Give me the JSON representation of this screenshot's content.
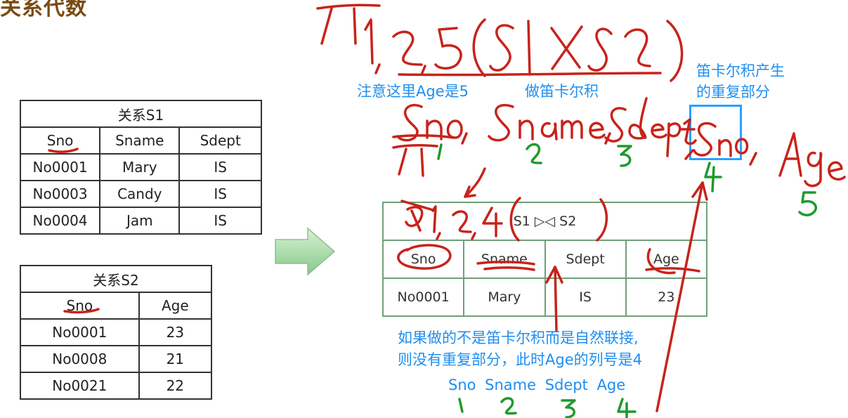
{
  "header": {
    "title_fragment": "关系代数"
  },
  "table_s1": {
    "caption": "关系S1",
    "headers": [
      "Sno",
      "Sname",
      "Sdept"
    ],
    "rows": [
      [
        "No0001",
        "Mary",
        "IS"
      ],
      [
        "No0003",
        "Candy",
        "IS"
      ],
      [
        "No0004",
        "Jam",
        "IS"
      ]
    ]
  },
  "table_s2": {
    "caption": "关系S2",
    "headers": [
      "Sno",
      "Age"
    ],
    "rows": [
      [
        "No0001",
        "23"
      ],
      [
        "No0008",
        "21"
      ],
      [
        "No0021",
        "22"
      ]
    ]
  },
  "result_table": {
    "caption": "S1 ▷◁ S2",
    "headers": [
      "Sno",
      "Sname",
      "Sdept",
      "Age"
    ],
    "rows": [
      [
        "No0001",
        "Mary",
        "IS",
        "23"
      ]
    ]
  },
  "notes": {
    "age_is_5": "注意这里Age是5",
    "do_cartesian": "做笛卡尔积",
    "cartesian_dup_line1": "笛卡尔积产生",
    "cartesian_dup_line2": "的重复部分",
    "natural_join_line1": "如果做的不是笛卡尔积而是自然联接,",
    "natural_join_line2": "则没有重复部分，此时Age的列号是4",
    "bottom_columns": "Sno  Sname  Sdept  Age"
  },
  "handwriting": {
    "formula": "π1,2,5(S1×S2)",
    "columns": [
      "Sno",
      "Sname",
      "Sdept",
      "Sno",
      "Age"
    ],
    "column_numbers": [
      "1",
      "2",
      "3",
      "4",
      "5"
    ],
    "pi_below": "π",
    "result_proj": "π1,2,4(",
    "bottom_numbers": [
      "1",
      "2",
      "3",
      "4"
    ]
  },
  "colors": {
    "ink_red": "#c8231b",
    "ink_green": "#1f9a2c",
    "note_blue": "#1e8ef0",
    "box_blue": "#2aa0ff"
  }
}
